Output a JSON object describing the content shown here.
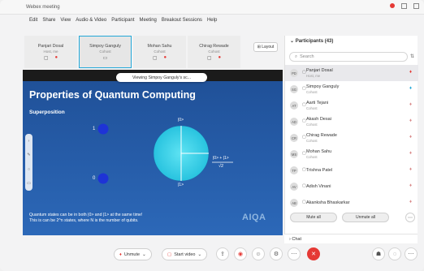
{
  "titlebar": {
    "title": "Webex meeting",
    "record_icon": "record-dot-icon"
  },
  "menubar": {
    "items": [
      "Edit",
      "Share",
      "View",
      "Audio & Video",
      "Participant",
      "Meeting",
      "Breakout Sessions",
      "Help"
    ]
  },
  "strip": {
    "tiles": [
      {
        "name": "Panjari Dosal",
        "role": "Host, me"
      },
      {
        "name": "Simpoy Ganguly",
        "role": "Cohost"
      },
      {
        "name": "Mohan Sahu",
        "role": "Cohost"
      },
      {
        "name": "Chirag Rewade",
        "role": "Cohost"
      }
    ],
    "layout_label": "Layout"
  },
  "slide": {
    "viewing_pill": "Viewing Simpoy Ganguly's sc...",
    "title": "Properties of Quantum Computing",
    "subtitle": "Superposition",
    "ket_one": "1",
    "ket_zero": "0",
    "circle_top": "|0>",
    "circle_bottom": "|1>",
    "formula_num": "|0> + |1>",
    "formula_den": "√2",
    "footnote_1": "Quantum states can be in both |0> and |1> at the same time!",
    "footnote_2": "This is can be 2^n states, where N is the number of qubits.",
    "logo": "AIQA"
  },
  "controls": {
    "unmute_label": "Unmute",
    "start_video_label": "Start video"
  },
  "panel": {
    "header": "Participants (43)",
    "search_placeholder": "Search",
    "participants": [
      {
        "initials": "PD",
        "name": "Panjari Dosal",
        "role": "Host, me",
        "mic": "on",
        "selected": true
      },
      {
        "initials": "SG",
        "name": "Simpoy Ganguly",
        "role": "Cohost",
        "mic": "on",
        "selected": false
      },
      {
        "initials": "AT",
        "name": "Aarti Tejani",
        "role": "Cohost",
        "mic": "mute",
        "selected": false
      },
      {
        "initials": "AD",
        "name": "Akash Desai",
        "role": "Cohost",
        "mic": "mute",
        "selected": false
      },
      {
        "initials": "CR",
        "name": "Chirag Rewade",
        "role": "Cohost",
        "mic": "mute",
        "selected": false
      },
      {
        "initials": "MS",
        "name": "Mohan Sahu",
        "role": "Cohost",
        "mic": "mute",
        "selected": false
      },
      {
        "initials": "TP",
        "name": "Trishna Patel",
        "role": "",
        "mic": "mute",
        "selected": false
      },
      {
        "initials": "AV",
        "name": "Adish Vinani",
        "role": "",
        "mic": "mute",
        "selected": false
      },
      {
        "initials": "AB",
        "name": "Akanksha Bhaskarkar",
        "role": "",
        "mic": "mute",
        "selected": false
      }
    ],
    "mute_all": "Mute all",
    "unmute_all": "Unmute all",
    "chat_label": "Chat"
  },
  "colors": {
    "accent": "#23a8d8",
    "slide_bg": "#2c68b8",
    "qubit_circle": "#35d3ec",
    "mic_red": "#e53935"
  }
}
